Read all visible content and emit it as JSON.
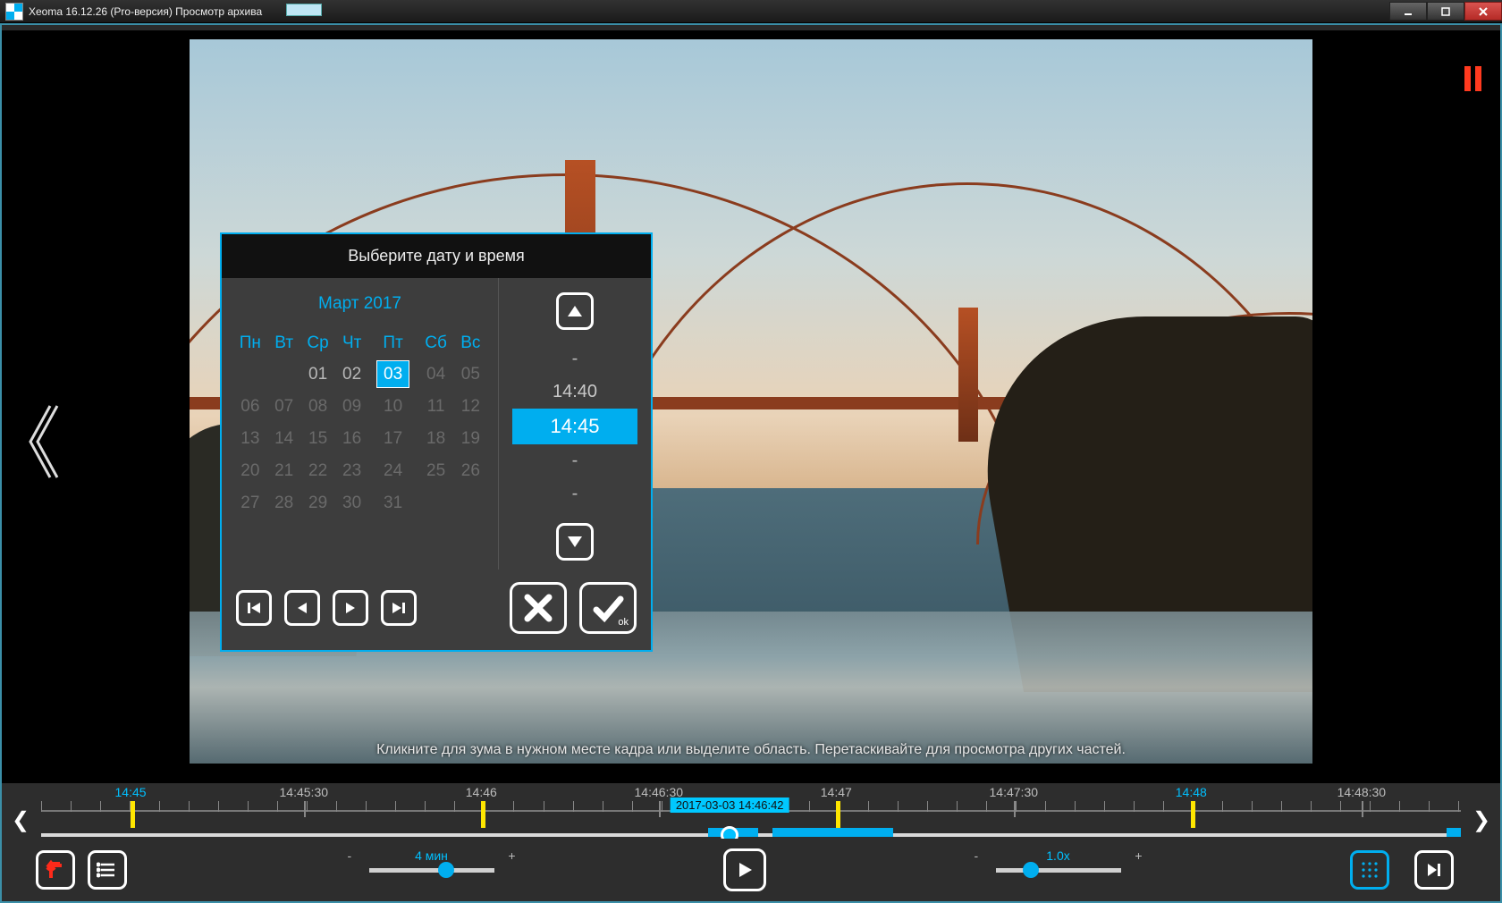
{
  "titlebar": {
    "text": "Xeoma 16.12.26 (Pro-версия) Просмотр архива"
  },
  "pause": true,
  "hint": "Кликните для зума в нужном месте кадра или выделите область. Перетаскивайте для просмотра других частей.",
  "dialog": {
    "title": "Выберите дату и время",
    "month": "Март 2017",
    "dow": [
      "Пн",
      "Вт",
      "Ср",
      "Чт",
      "Пт",
      "Сб",
      "Вс"
    ],
    "weeks": [
      [
        {
          "d": ""
        },
        {
          "d": ""
        },
        {
          "d": "01"
        },
        {
          "d": "02"
        },
        {
          "d": "03",
          "sel": true
        },
        {
          "d": "04",
          "mute": true
        },
        {
          "d": "05",
          "mute": true
        }
      ],
      [
        {
          "d": "06",
          "mute": true
        },
        {
          "d": "07",
          "mute": true
        },
        {
          "d": "08",
          "mute": true
        },
        {
          "d": "09",
          "mute": true
        },
        {
          "d": "10",
          "mute": true
        },
        {
          "d": "11",
          "mute": true
        },
        {
          "d": "12",
          "mute": true
        }
      ],
      [
        {
          "d": "13",
          "mute": true
        },
        {
          "d": "14",
          "mute": true
        },
        {
          "d": "15",
          "mute": true
        },
        {
          "d": "16",
          "mute": true
        },
        {
          "d": "17",
          "mute": true
        },
        {
          "d": "18",
          "mute": true
        },
        {
          "d": "19",
          "mute": true
        }
      ],
      [
        {
          "d": "20",
          "mute": true
        },
        {
          "d": "21",
          "mute": true
        },
        {
          "d": "22",
          "mute": true
        },
        {
          "d": "23",
          "mute": true
        },
        {
          "d": "24",
          "mute": true
        },
        {
          "d": "25",
          "mute": true
        },
        {
          "d": "26",
          "mute": true
        }
      ],
      [
        {
          "d": "27",
          "mute": true
        },
        {
          "d": "28",
          "mute": true
        },
        {
          "d": "29",
          "mute": true
        },
        {
          "d": "30",
          "mute": true
        },
        {
          "d": "31",
          "mute": true
        },
        {
          "d": ""
        },
        {
          "d": ""
        }
      ]
    ],
    "times": [
      "-",
      "14:40",
      "14:45",
      "-",
      "-"
    ],
    "selected_time_index": 2,
    "ok": "ok"
  },
  "timeline": {
    "labels": [
      {
        "t": "14:45",
        "pct": 6.3,
        "hl": true
      },
      {
        "t": "14:45:30",
        "pct": 18.5
      },
      {
        "t": "14:46",
        "pct": 31.0
      },
      {
        "t": "14:46:30",
        "pct": 43.5
      },
      {
        "t": "14:47",
        "pct": 56.0
      },
      {
        "t": "14:47:30",
        "pct": 68.5
      },
      {
        "t": "14:48",
        "pct": 81.0,
        "hl": true
      },
      {
        "t": "14:48:30",
        "pct": 93.0
      }
    ],
    "marks": [
      6.3,
      31.0,
      56.0,
      81.0
    ],
    "segments": [
      {
        "from": 47.0,
        "to": 50.5
      },
      {
        "from": 51.5,
        "to": 60.0
      },
      {
        "from": 99.0,
        "to": 100.0
      }
    ],
    "head_pct": 48.5,
    "badge": "2017-03-03 14:46:42"
  },
  "toolbar": {
    "interval": {
      "label": "4 мин",
      "thumb_pct": 62
    },
    "speed": {
      "label": "1.0x",
      "thumb_pct": 28
    }
  }
}
